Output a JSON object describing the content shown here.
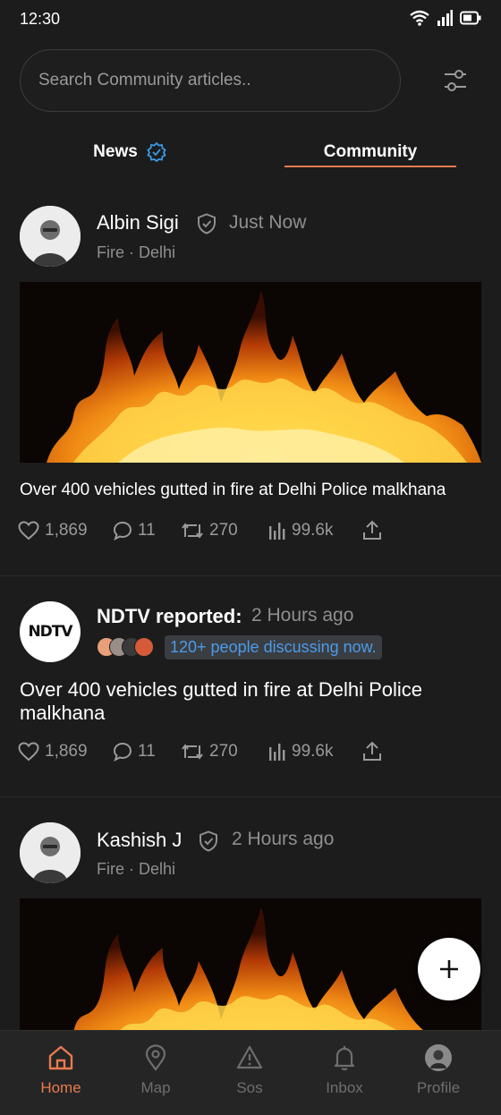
{
  "status_bar": {
    "time": "12:30"
  },
  "search": {
    "placeholder": "Search Community articles.."
  },
  "tabs": [
    {
      "label": "News",
      "active": false
    },
    {
      "label": "Community",
      "active": true
    }
  ],
  "colors": {
    "accent": "#e87a4f",
    "verified": "#3a9be8",
    "link": "#4c9be8",
    "background": "#1c1c1c"
  },
  "posts": [
    {
      "author": "Albin Sigi",
      "time": "Just Now",
      "category": "Fire · Delhi",
      "text": "Over 400 vehicles gutted in fire at Delhi Police malkhana",
      "stats": {
        "likes": "1,869",
        "comments": "11",
        "reposts": "270",
        "views": "99.6k"
      }
    },
    {
      "author": "NDTV reported:",
      "logo_text": "NDTV",
      "time": "2 Hours ago",
      "discussion": "120+ people discussing now.",
      "text": "Over 400 vehicles gutted in fire at Delhi Police malkhana",
      "stats": {
        "likes": "1,869",
        "comments": "11",
        "reposts": "270",
        "views": "99.6k"
      }
    },
    {
      "author": "Kashish J",
      "time": "2 Hours ago",
      "category": "Fire · Delhi"
    }
  ],
  "bottom_nav": [
    {
      "label": "Home",
      "icon": "home-icon",
      "active": true
    },
    {
      "label": "Map",
      "icon": "map-pin-icon",
      "active": false
    },
    {
      "label": "Sos",
      "icon": "warning-icon",
      "active": false
    },
    {
      "label": "Inbox",
      "icon": "bell-icon",
      "active": false
    },
    {
      "label": "Profile",
      "icon": "profile-avatar",
      "active": false
    }
  ]
}
